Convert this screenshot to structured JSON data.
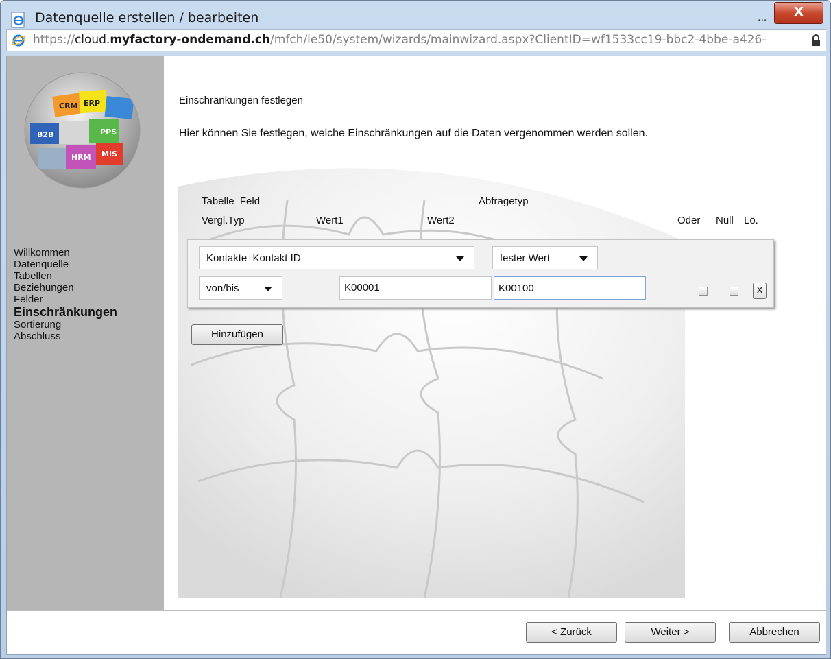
{
  "window": {
    "title": "Datenquelle erstellen / bearbeiten",
    "overflow_dots": "...",
    "close_label": "X"
  },
  "address": {
    "url_scheme": "https://",
    "url_sub": "cloud.",
    "url_domain": "myfactory-ondemand.ch",
    "url_path": "/mfch/ie50/system/wizards/mainwizard.aspx?ClientID=wf1533cc19-bbc2-4bbe-a426-"
  },
  "sidebar": {
    "logo_icon": "myfactory-globe-logo",
    "items": [
      {
        "label": "Willkommen",
        "active": false
      },
      {
        "label": "Datenquelle",
        "active": false
      },
      {
        "label": "Tabellen",
        "active": false
      },
      {
        "label": "Beziehungen",
        "active": false
      },
      {
        "label": "Felder",
        "active": false
      },
      {
        "label": "Einschränkungen",
        "active": true
      },
      {
        "label": "Sortierung",
        "active": false
      },
      {
        "label": "Abschluss",
        "active": false
      }
    ]
  },
  "main": {
    "heading": "Einschränkungen festlegen",
    "subheading": "Hier können Sie festlegen, welche Einschränkungen auf die Daten vergenommen werden sollen.",
    "headers": {
      "tabelle_feld": "Tabelle_Feld",
      "abfragetyp": "Abfragetyp",
      "vergl_typ": "Vergl.Typ",
      "wert1": "Wert1",
      "wert2": "Wert2",
      "oder": "Oder",
      "null": "Null",
      "loeschen": "Lö."
    },
    "row": {
      "field": "Kontakte_Kontakt ID",
      "query_type": "fester Wert",
      "compare_type": "von/bis",
      "value1": "K00001",
      "value2": "K00100",
      "oder_checked": false,
      "null_checked": false,
      "delete_label": "X"
    },
    "add_button": "Hinzufügen"
  },
  "footer": {
    "back": "< Zurück",
    "next": "Weiter >",
    "cancel": "Abbrechen"
  },
  "colors": {
    "sidebar_bg": "#b6b6b6",
    "frame": "#c9dbef",
    "close_red": "#c84a2f"
  }
}
